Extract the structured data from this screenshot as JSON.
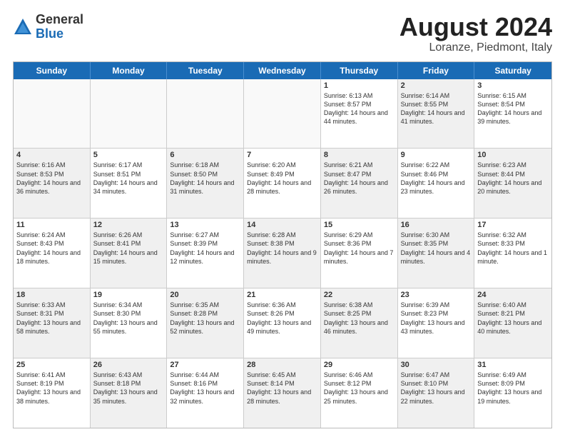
{
  "logo": {
    "general": "General",
    "blue": "Blue"
  },
  "title": {
    "month": "August 2024",
    "location": "Loranze, Piedmont, Italy"
  },
  "days": [
    "Sunday",
    "Monday",
    "Tuesday",
    "Wednesday",
    "Thursday",
    "Friday",
    "Saturday"
  ],
  "weeks": [
    [
      {
        "day": "",
        "text": "",
        "empty": true
      },
      {
        "day": "",
        "text": "",
        "empty": true
      },
      {
        "day": "",
        "text": "",
        "empty": true
      },
      {
        "day": "",
        "text": "",
        "empty": true
      },
      {
        "day": "1",
        "text": "Sunrise: 6:13 AM\nSunset: 8:57 PM\nDaylight: 14 hours and 44 minutes.",
        "shaded": false
      },
      {
        "day": "2",
        "text": "Sunrise: 6:14 AM\nSunset: 8:55 PM\nDaylight: 14 hours and 41 minutes.",
        "shaded": true
      },
      {
        "day": "3",
        "text": "Sunrise: 6:15 AM\nSunset: 8:54 PM\nDaylight: 14 hours and 39 minutes.",
        "shaded": false
      }
    ],
    [
      {
        "day": "4",
        "text": "Sunrise: 6:16 AM\nSunset: 8:53 PM\nDaylight: 14 hours and 36 minutes.",
        "shaded": true
      },
      {
        "day": "5",
        "text": "Sunrise: 6:17 AM\nSunset: 8:51 PM\nDaylight: 14 hours and 34 minutes.",
        "shaded": false
      },
      {
        "day": "6",
        "text": "Sunrise: 6:18 AM\nSunset: 8:50 PM\nDaylight: 14 hours and 31 minutes.",
        "shaded": true
      },
      {
        "day": "7",
        "text": "Sunrise: 6:20 AM\nSunset: 8:49 PM\nDaylight: 14 hours and 28 minutes.",
        "shaded": false
      },
      {
        "day": "8",
        "text": "Sunrise: 6:21 AM\nSunset: 8:47 PM\nDaylight: 14 hours and 26 minutes.",
        "shaded": true
      },
      {
        "day": "9",
        "text": "Sunrise: 6:22 AM\nSunset: 8:46 PM\nDaylight: 14 hours and 23 minutes.",
        "shaded": false
      },
      {
        "day": "10",
        "text": "Sunrise: 6:23 AM\nSunset: 8:44 PM\nDaylight: 14 hours and 20 minutes.",
        "shaded": true
      }
    ],
    [
      {
        "day": "11",
        "text": "Sunrise: 6:24 AM\nSunset: 8:43 PM\nDaylight: 14 hours and 18 minutes.",
        "shaded": false
      },
      {
        "day": "12",
        "text": "Sunrise: 6:26 AM\nSunset: 8:41 PM\nDaylight: 14 hours and 15 minutes.",
        "shaded": true
      },
      {
        "day": "13",
        "text": "Sunrise: 6:27 AM\nSunset: 8:39 PM\nDaylight: 14 hours and 12 minutes.",
        "shaded": false
      },
      {
        "day": "14",
        "text": "Sunrise: 6:28 AM\nSunset: 8:38 PM\nDaylight: 14 hours and 9 minutes.",
        "shaded": true
      },
      {
        "day": "15",
        "text": "Sunrise: 6:29 AM\nSunset: 8:36 PM\nDaylight: 14 hours and 7 minutes.",
        "shaded": false
      },
      {
        "day": "16",
        "text": "Sunrise: 6:30 AM\nSunset: 8:35 PM\nDaylight: 14 hours and 4 minutes.",
        "shaded": true
      },
      {
        "day": "17",
        "text": "Sunrise: 6:32 AM\nSunset: 8:33 PM\nDaylight: 14 hours and 1 minute.",
        "shaded": false
      }
    ],
    [
      {
        "day": "18",
        "text": "Sunrise: 6:33 AM\nSunset: 8:31 PM\nDaylight: 13 hours and 58 minutes.",
        "shaded": true
      },
      {
        "day": "19",
        "text": "Sunrise: 6:34 AM\nSunset: 8:30 PM\nDaylight: 13 hours and 55 minutes.",
        "shaded": false
      },
      {
        "day": "20",
        "text": "Sunrise: 6:35 AM\nSunset: 8:28 PM\nDaylight: 13 hours and 52 minutes.",
        "shaded": true
      },
      {
        "day": "21",
        "text": "Sunrise: 6:36 AM\nSunset: 8:26 PM\nDaylight: 13 hours and 49 minutes.",
        "shaded": false
      },
      {
        "day": "22",
        "text": "Sunrise: 6:38 AM\nSunset: 8:25 PM\nDaylight: 13 hours and 46 minutes.",
        "shaded": true
      },
      {
        "day": "23",
        "text": "Sunrise: 6:39 AM\nSunset: 8:23 PM\nDaylight: 13 hours and 43 minutes.",
        "shaded": false
      },
      {
        "day": "24",
        "text": "Sunrise: 6:40 AM\nSunset: 8:21 PM\nDaylight: 13 hours and 40 minutes.",
        "shaded": true
      }
    ],
    [
      {
        "day": "25",
        "text": "Sunrise: 6:41 AM\nSunset: 8:19 PM\nDaylight: 13 hours and 38 minutes.",
        "shaded": false
      },
      {
        "day": "26",
        "text": "Sunrise: 6:43 AM\nSunset: 8:18 PM\nDaylight: 13 hours and 35 minutes.",
        "shaded": true
      },
      {
        "day": "27",
        "text": "Sunrise: 6:44 AM\nSunset: 8:16 PM\nDaylight: 13 hours and 32 minutes.",
        "shaded": false
      },
      {
        "day": "28",
        "text": "Sunrise: 6:45 AM\nSunset: 8:14 PM\nDaylight: 13 hours and 28 minutes.",
        "shaded": true
      },
      {
        "day": "29",
        "text": "Sunrise: 6:46 AM\nSunset: 8:12 PM\nDaylight: 13 hours and 25 minutes.",
        "shaded": false
      },
      {
        "day": "30",
        "text": "Sunrise: 6:47 AM\nSunset: 8:10 PM\nDaylight: 13 hours and 22 minutes.",
        "shaded": true
      },
      {
        "day": "31",
        "text": "Sunrise: 6:49 AM\nSunset: 8:09 PM\nDaylight: 13 hours and 19 minutes.",
        "shaded": false
      }
    ]
  ]
}
